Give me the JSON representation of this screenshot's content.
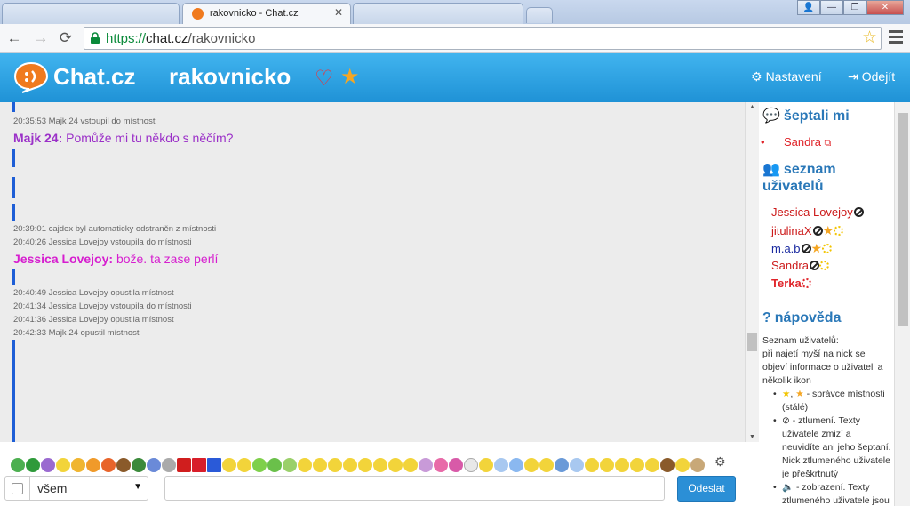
{
  "browser": {
    "tabs": [
      {
        "title": "",
        "active": false
      },
      {
        "title": "rakovnicko - Chat.cz",
        "active": true
      },
      {
        "title": "",
        "active": false
      }
    ],
    "url_scheme": "https://",
    "url_host": "chat.cz",
    "url_path": "/rakovnicko"
  },
  "header": {
    "logo": "Chat.cz",
    "room": "rakovnicko",
    "settings": "Nastavení",
    "logout": "Odejít"
  },
  "chat": {
    "lines": [
      {
        "type": "sys",
        "text": "20:35:53 Majk 24 vstoupil do místnosti"
      },
      {
        "type": "msg",
        "nick": "Majk 24:",
        "text": "Pomůže mi tu někdo s něčím?",
        "color": "#9b30c8"
      },
      {
        "type": "sys",
        "text": "20:39:01 cajdex byl automaticky odstraněn z místnosti"
      },
      {
        "type": "sys",
        "text": "20:40:26 Jessica Lovejoy vstoupila do místnosti"
      },
      {
        "type": "msg",
        "nick": "Jessica Lovejoy:",
        "text": "bože. ta zase perlí",
        "color": "#d61ecf"
      },
      {
        "type": "sys",
        "text": "20:40:49 Jessica Lovejoy opustila místnost"
      },
      {
        "type": "sys",
        "text": "20:41:34 Jessica Lovejoy vstoupila do místnosti"
      },
      {
        "type": "sys",
        "text": "20:41:36 Jessica Lovejoy opustila místnost"
      },
      {
        "type": "sys",
        "text": "20:42:33 Majk 24 opustil místnost"
      }
    ]
  },
  "sidebar": {
    "whispers_title": "šeptali mi",
    "whispers": [
      "Sandra"
    ],
    "users_title": "seznam uživatelů",
    "users": [
      {
        "name": "Jessica Lovejoy",
        "color": "#cc1a1a"
      },
      {
        "name": "jitulinaX",
        "color": "#cc1a1a"
      },
      {
        "name": "m.a.b",
        "color": "#1a2aa0"
      },
      {
        "name": "Sandra",
        "color": "#cc1a1a"
      },
      {
        "name": "Terka",
        "color": "#e0242a"
      }
    ],
    "help_title": "nápověda",
    "help_intro": [
      "Seznam uživatelů:",
      "při najetí myší na nick se",
      "objeví informace o uživateli a",
      "několik ikon"
    ],
    "help_items": [
      [
        "- správce místnosti",
        "(stálé)"
      ],
      [
        "- ztlumení. Texty",
        "uživatele zmizí a",
        "neuvidíte ani jeho šeptaní.",
        "Nick ztlumeného uživatele",
        "je přeškrtnutý"
      ],
      [
        "- zobrazení. Texty",
        "ztlumeného uživatele jsou"
      ]
    ]
  },
  "input": {
    "recipient": "všem",
    "send": "Odeslat"
  }
}
